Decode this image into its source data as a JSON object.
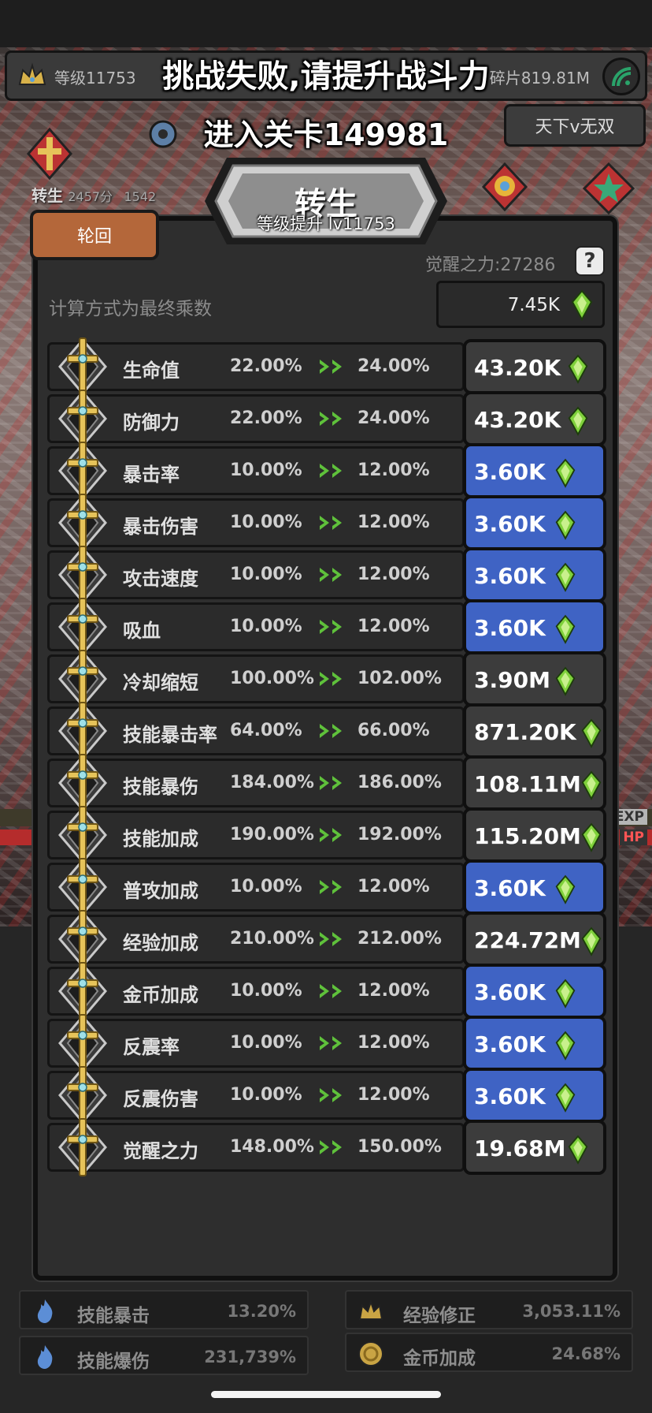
{
  "hud": {
    "level": "等级11753",
    "shards": "碎片819.81M",
    "tianxia_button": "天下v无双",
    "rebirth_bg": "转生",
    "rebirth_bg_meta1": "2457分",
    "rebirth_bg_meta2": "1542",
    "exp_label": "EXP",
    "hp_label": "HP"
  },
  "toast": {
    "message": "挑战失败,请提升战斗力",
    "stage": "进入关卡149981"
  },
  "panel": {
    "tab": "轮回",
    "title": "转生",
    "subtitle": "等级提升 lv11753",
    "awaken_power": "觉醒之力:27286",
    "help": "?",
    "calc_method": "计算方式为最终乘数",
    "total_cost": "7.45K"
  },
  "rows": [
    {
      "name": "生命值",
      "current": "22.00%",
      "next": "24.00%",
      "cost": "43.20K",
      "affordable": false
    },
    {
      "name": "防御力",
      "current": "22.00%",
      "next": "24.00%",
      "cost": "43.20K",
      "affordable": false
    },
    {
      "name": "暴击率",
      "current": "10.00%",
      "next": "12.00%",
      "cost": "3.60K",
      "affordable": true
    },
    {
      "name": "暴击伤害",
      "current": "10.00%",
      "next": "12.00%",
      "cost": "3.60K",
      "affordable": true
    },
    {
      "name": "攻击速度",
      "current": "10.00%",
      "next": "12.00%",
      "cost": "3.60K",
      "affordable": true
    },
    {
      "name": "吸血",
      "current": "10.00%",
      "next": "12.00%",
      "cost": "3.60K",
      "affordable": true
    },
    {
      "name": "冷却缩短",
      "current": "100.00%",
      "next": "102.00%",
      "cost": "3.90M",
      "affordable": false
    },
    {
      "name": "技能暴击率",
      "current": "64.00%",
      "next": "66.00%",
      "cost": "871.20K",
      "affordable": false
    },
    {
      "name": "技能暴伤",
      "current": "184.00%",
      "next": "186.00%",
      "cost": "108.11M",
      "affordable": false
    },
    {
      "name": "技能加成",
      "current": "190.00%",
      "next": "192.00%",
      "cost": "115.20M",
      "affordable": false
    },
    {
      "name": "普攻加成",
      "current": "10.00%",
      "next": "12.00%",
      "cost": "3.60K",
      "affordable": true
    },
    {
      "name": "经验加成",
      "current": "210.00%",
      "next": "212.00%",
      "cost": "224.72M",
      "affordable": false
    },
    {
      "name": "金币加成",
      "current": "10.00%",
      "next": "12.00%",
      "cost": "3.60K",
      "affordable": true
    },
    {
      "name": "反震率",
      "current": "10.00%",
      "next": "12.00%",
      "cost": "3.60K",
      "affordable": true
    },
    {
      "name": "反震伤害",
      "current": "10.00%",
      "next": "12.00%",
      "cost": "3.60K",
      "affordable": true
    },
    {
      "name": "觉醒之力",
      "current": "148.00%",
      "next": "150.00%",
      "cost": "19.68M",
      "affordable": false
    }
  ],
  "bottom_stats": [
    {
      "label": "技能暴击",
      "value": "13.20%",
      "icon": "flame-icon"
    },
    {
      "label": "经验修正",
      "value": "3,053.11%",
      "icon": "crown-icon"
    },
    {
      "label": "技能爆伤",
      "value": "231,739%",
      "icon": "flame-icon"
    },
    {
      "label": "金币加成",
      "value": "24.68%",
      "icon": "coin-icon"
    }
  ],
  "colors": {
    "panel_bg": "#2e2e2e",
    "cost_blue": "#3f63c4",
    "cost_gray": "#3c3c3c",
    "tab_orange": "#b4673a",
    "gem_green": "#7fd13b",
    "hp_red": "#b52c2c"
  }
}
